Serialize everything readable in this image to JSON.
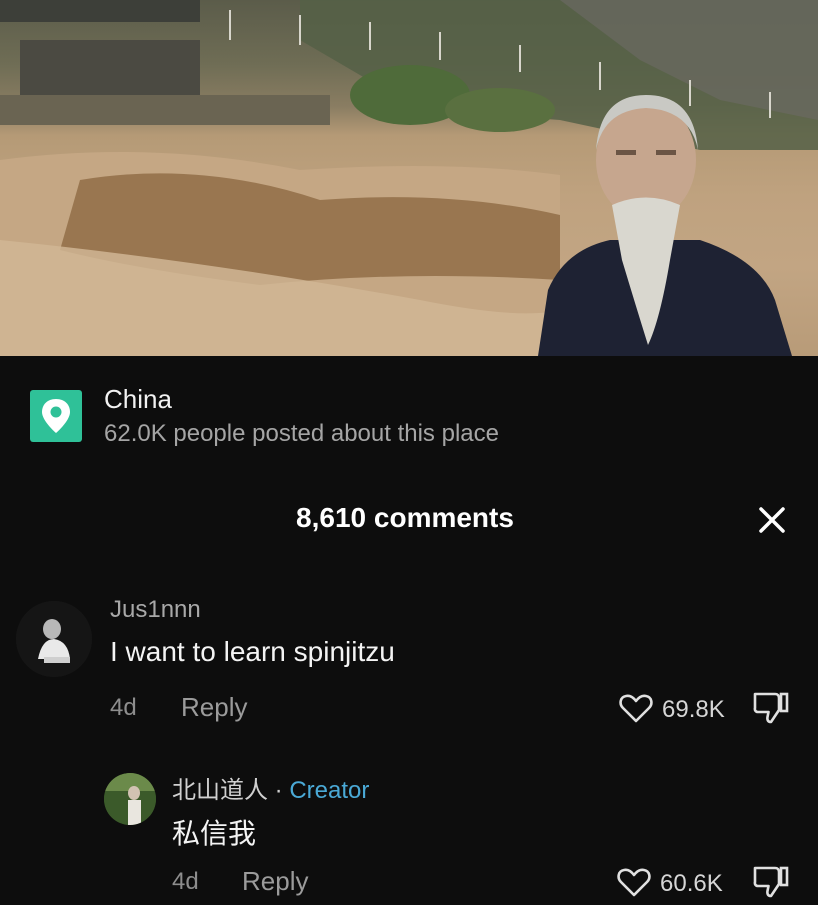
{
  "location": {
    "name": "China",
    "subtitle": "62.0K people posted about this place"
  },
  "header": {
    "comments_count": "8,610 comments"
  },
  "comments": [
    {
      "username": "Jus1nnn",
      "text": "I want to learn spinjitzu",
      "time": "4d",
      "reply_label": "Reply",
      "likes": "69.8K"
    },
    {
      "username": "北山道人",
      "separator": " · ",
      "badge": "Creator",
      "text": "私信我",
      "time": "4d",
      "reply_label": "Reply",
      "likes": "60.6K"
    }
  ],
  "colors": {
    "background": "#0d0d0d",
    "location_pin": "#2fc198",
    "creator_badge": "#4aa9d6"
  },
  "icons": {
    "location": "location-pin-icon",
    "close": "close-icon",
    "like": "heart-outline-icon",
    "dislike": "thumbs-down-icon"
  }
}
